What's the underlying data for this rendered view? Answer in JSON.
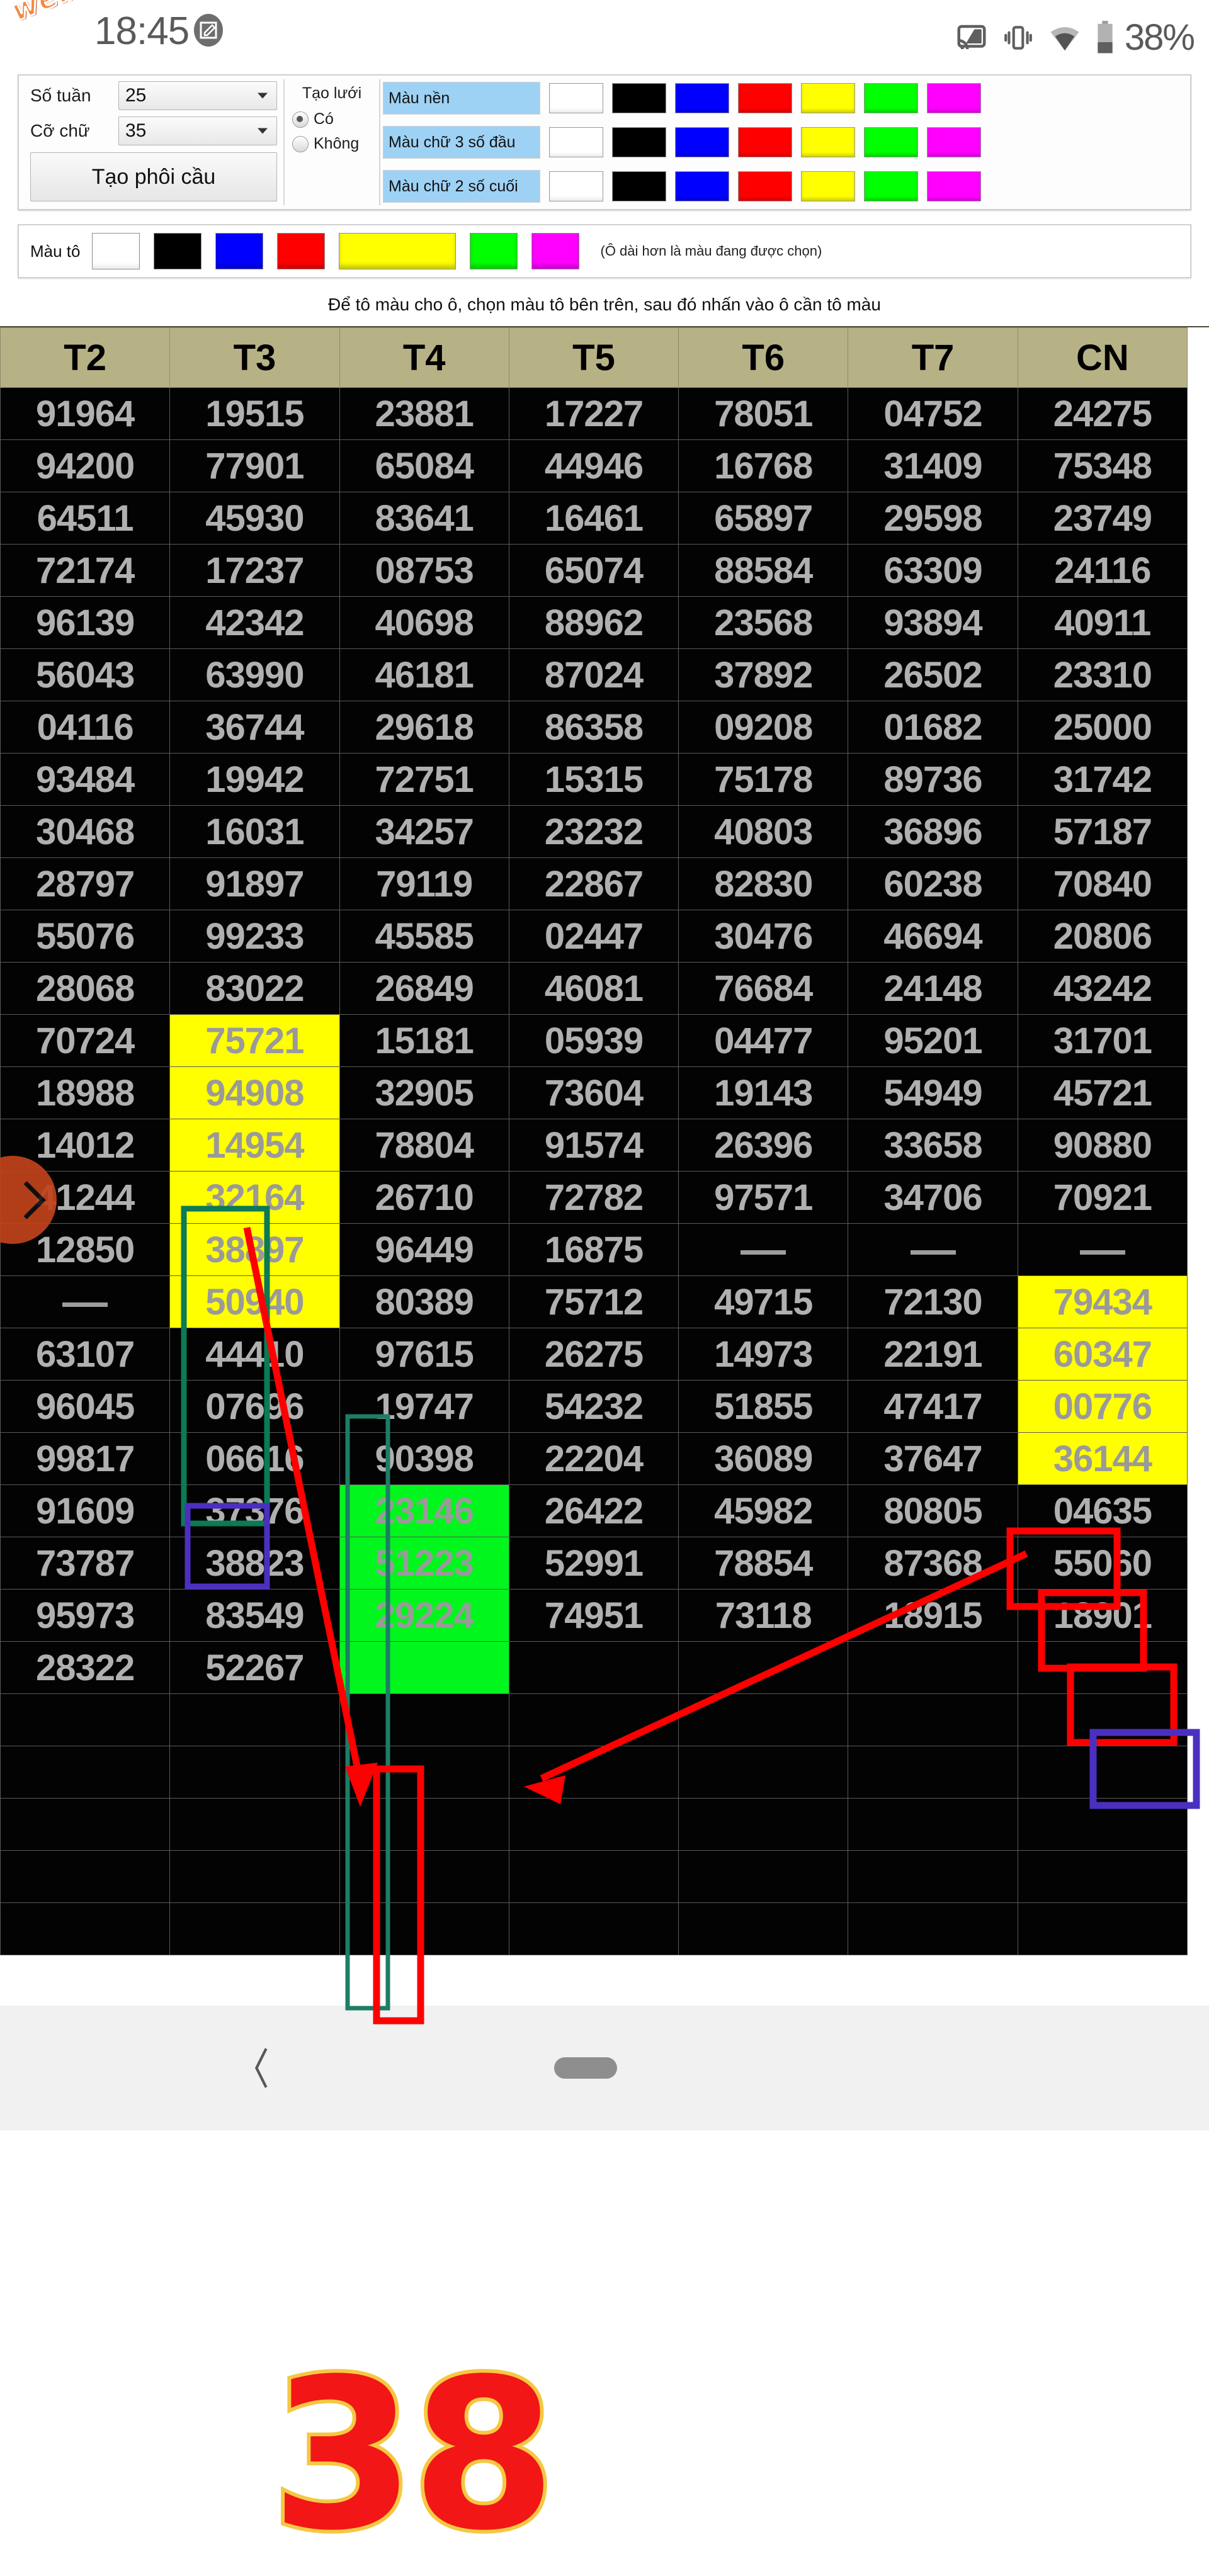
{
  "statusbar": {
    "watermark": "webxoso.net",
    "time": "18:45",
    "battery": "38%",
    "icons": [
      "screen-cast-icon",
      "vibrate-icon",
      "wifi-icon",
      "battery-icon"
    ]
  },
  "toolbar": {
    "weeks_label": "Số tuần",
    "weeks_value": "25",
    "fontsize_label": "Cỡ chữ",
    "fontsize_value": "35",
    "create_button": "Tạo phôi cầu",
    "grid_title": "Tạo lưới",
    "grid_yes": "Có",
    "grid_no": "Không",
    "grid_selected": "Có",
    "color_rows": [
      {
        "label": "Màu nền"
      },
      {
        "label": "Màu chữ 3 số đầu"
      },
      {
        "label": "Màu chữ 2 số cuối"
      }
    ],
    "swatches": [
      "#ffffff",
      "#000000",
      "#0000ff",
      "#ff0000",
      "#ffff00",
      "#00ff00",
      "#ff00ff"
    ]
  },
  "fillbar": {
    "label": "Màu tô",
    "swatches": [
      "#ffffff",
      "#000000",
      "#0000ff",
      "#ff0000",
      "#ffff00",
      "#00ff00",
      "#ff00ff"
    ],
    "selected": "#ffff00",
    "note": "(Ô dài hơn là màu đang được chọn)"
  },
  "hint": "Để tô màu cho ô, chọn màu tô bên trên, sau đó nhấn vào ô cần tô màu",
  "chart_data": {
    "type": "table",
    "title": "",
    "columns": [
      "T2",
      "T3",
      "T4",
      "T5",
      "T6",
      "T7",
      "CN"
    ],
    "rows": [
      [
        "91964",
        "19515",
        "23881",
        "17227",
        "78051",
        "04752",
        "24275"
      ],
      [
        "94200",
        "77901",
        "65084",
        "44946",
        "16768",
        "31409",
        "75348"
      ],
      [
        "64511",
        "45930",
        "83641",
        "16461",
        "65897",
        "29598",
        "23749"
      ],
      [
        "72174",
        "17237",
        "08753",
        "65074",
        "88584",
        "63309",
        "24116"
      ],
      [
        "96139",
        "42342",
        "40698",
        "88962",
        "23568",
        "93894",
        "40911"
      ],
      [
        "56043",
        "63990",
        "46181",
        "87024",
        "37892",
        "26502",
        "23310"
      ],
      [
        "04116",
        "36744",
        "29618",
        "86358",
        "09208",
        "01682",
        "25000"
      ],
      [
        "93484",
        "19942",
        "72751",
        "15315",
        "75178",
        "89736",
        "31742"
      ],
      [
        "30468",
        "16031",
        "34257",
        "23232",
        "40803",
        "36896",
        "57187"
      ],
      [
        "28797",
        "91897",
        "79119",
        "22867",
        "82830",
        "60238",
        "70840"
      ],
      [
        "55076",
        "99233",
        "45585",
        "02447",
        "30476",
        "46694",
        "20806"
      ],
      [
        "28068",
        "83022",
        "26849",
        "46081",
        "76684",
        "24148",
        "43242"
      ],
      [
        "70724",
        "75721",
        "15181",
        "05939",
        "04477",
        "95201",
        "31701"
      ],
      [
        "18988",
        "94908",
        "32905",
        "73604",
        "19143",
        "54949",
        "45721"
      ],
      [
        "14012",
        "14954",
        "78804",
        "91574",
        "26396",
        "33658",
        "90880"
      ],
      [
        "41244",
        "32164",
        "26710",
        "72782",
        "97571",
        "34706",
        "70921"
      ],
      [
        "12850",
        "38897",
        "96449",
        "16875",
        "—",
        "—",
        "—"
      ],
      [
        "—",
        "50940",
        "80389",
        "75712",
        "49715",
        "72130",
        "79434"
      ],
      [
        "63107",
        "44410",
        "97615",
        "26275",
        "14973",
        "22191",
        "60347"
      ],
      [
        "96045",
        "07696",
        "19747",
        "54232",
        "51855",
        "47417",
        "00776"
      ],
      [
        "99817",
        "06616",
        "90398",
        "22204",
        "36089",
        "37647",
        "36144"
      ],
      [
        "91609",
        "37376",
        "23146",
        "26422",
        "45982",
        "80805",
        "04635"
      ],
      [
        "73787",
        "38823",
        "51223",
        "52991",
        "78854",
        "87368",
        "55060"
      ],
      [
        "95973",
        "83549",
        "29224",
        "74951",
        "73118",
        "18915",
        "18901"
      ],
      [
        "28322",
        "52267",
        "",
        "",
        "",
        "",
        "",
        ""
      ],
      [
        "",
        "",
        "",
        "",
        "",
        "",
        ""
      ],
      [
        "",
        "",
        "",
        "",
        "",
        "",
        ""
      ],
      [
        "",
        "",
        "",
        "",
        "",
        "",
        ""
      ],
      [
        "",
        "",
        "",
        "",
        "",
        "",
        ""
      ],
      [
        "",
        "",
        "",
        "",
        "",
        "",
        ""
      ]
    ],
    "highlight_yellow": [
      {
        "row": 12,
        "col": 1
      },
      {
        "row": 13,
        "col": 1
      },
      {
        "row": 14,
        "col": 1
      },
      {
        "row": 15,
        "col": 1
      },
      {
        "row": 16,
        "col": 1
      },
      {
        "row": 17,
        "col": 1
      },
      {
        "row": 17,
        "col": 6
      },
      {
        "row": 18,
        "col": 6
      },
      {
        "row": 19,
        "col": 6
      },
      {
        "row": 20,
        "col": 6
      }
    ],
    "highlight_green": [
      {
        "row": 21,
        "col": 2
      },
      {
        "row": 22,
        "col": 2
      },
      {
        "row": 23,
        "col": 2
      },
      {
        "row": 24,
        "col": 2
      }
    ],
    "header_bg": "#b7b286",
    "cell_bg": "#030303",
    "cell_text": "#b0b0b0",
    "yellow": "#ffff00",
    "green": "#00f61c"
  },
  "annotations": {
    "big_number": "38",
    "big_number_fill": "#f21616",
    "big_number_stroke": "#f5c842",
    "box_teal": "#0b7a55",
    "box_red": "#ff0000",
    "box_purple": "#4b30c0",
    "arrow_color": "#ff0000"
  },
  "fab": {
    "icon": "chevron-right-icon",
    "color": "#c0431b"
  },
  "navbar": {
    "back": "back-icon",
    "home": "home-pill-icon"
  }
}
